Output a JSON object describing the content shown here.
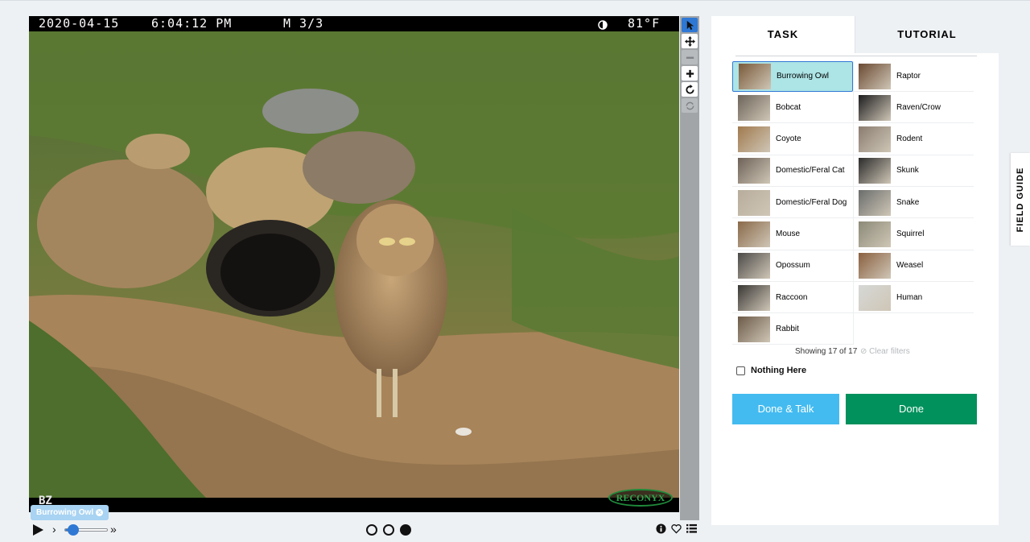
{
  "camera": {
    "date": "2020-04-15",
    "time": "6:04:12 PM",
    "mode": "M 3/3",
    "moon_icon": "moon-half-icon",
    "temperature": "81°F",
    "camera_id": "BZ",
    "brand": "RECONYX"
  },
  "tools": [
    {
      "name": "pointer-icon",
      "active": true
    },
    {
      "name": "move-icon",
      "active": false
    },
    {
      "name": "zoom-out-icon",
      "disabled": true
    },
    {
      "name": "zoom-in-icon",
      "active": false
    },
    {
      "name": "rotate-icon",
      "active": false
    },
    {
      "name": "reset-icon",
      "disabled": true
    }
  ],
  "mark": {
    "label": "Burrowing Owl",
    "close_icon": "close-icon"
  },
  "playback": {
    "play_icon": "play-icon",
    "step_back": "›",
    "step_forward": "»",
    "progress": 0.15,
    "frames": [
      {
        "active": false
      },
      {
        "active": false
      },
      {
        "active": true
      }
    ]
  },
  "meta_icons": [
    "info-icon",
    "heart-icon",
    "list-icon"
  ],
  "tabs": {
    "task": "TASK",
    "tutorial": "TUTORIAL"
  },
  "choices": [
    {
      "label": "Burrowing Owl",
      "selected": true,
      "color": "#7a5a3a"
    },
    {
      "label": "Raptor",
      "selected": false,
      "color": "#6b4a33"
    },
    {
      "label": "Bobcat",
      "selected": false,
      "color": "#6d645a"
    },
    {
      "label": "Raven/Crow",
      "selected": false,
      "color": "#1c1c1e"
    },
    {
      "label": "Coyote",
      "selected": false,
      "color": "#a07a4e"
    },
    {
      "label": "Rodent",
      "selected": false,
      "color": "#8a7d70"
    },
    {
      "label": "Domestic/Feral Cat",
      "selected": false,
      "color": "#6e6258"
    },
    {
      "label": "Skunk",
      "selected": false,
      "color": "#2b2b2b"
    },
    {
      "label": "Domestic/Feral Dog",
      "selected": false,
      "color": "#b8ad9c"
    },
    {
      "label": "Snake",
      "selected": false,
      "color": "#6a6d6c"
    },
    {
      "label": "Mouse",
      "selected": false,
      "color": "#8a6a4a"
    },
    {
      "label": "Squirrel",
      "selected": false,
      "color": "#8c8a78"
    },
    {
      "label": "Opossum",
      "selected": false,
      "color": "#4c4a48"
    },
    {
      "label": "Weasel",
      "selected": false,
      "color": "#8a6040"
    },
    {
      "label": "Raccoon",
      "selected": false,
      "color": "#3a3836"
    },
    {
      "label": "Human",
      "selected": false,
      "color": "#d6d8d6"
    },
    {
      "label": "Rabbit",
      "selected": false,
      "color": "#6c5a48"
    }
  ],
  "filter": {
    "showing": "Showing 17 of 17",
    "clear": "Clear filters"
  },
  "nothing_here": "Nothing Here",
  "buttons": {
    "done_talk": "Done & Talk",
    "done": "Done"
  },
  "field_guide": "FIELD GUIDE",
  "colors": {
    "accent": "#2f78d4",
    "talk": "#43bbf0",
    "done": "#00915c",
    "selected": "#ade4e6"
  }
}
